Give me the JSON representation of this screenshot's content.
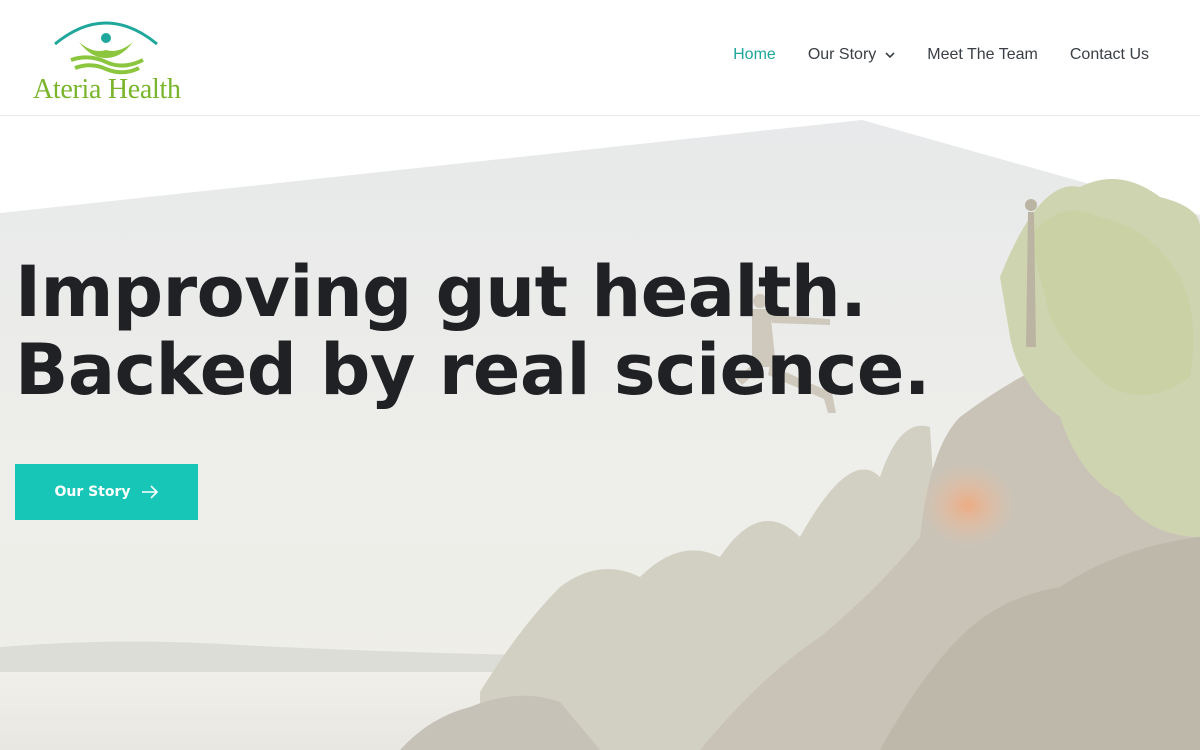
{
  "brand": {
    "name": "Ateria Health",
    "colors": {
      "teal": "#1ea79a",
      "green": "#7ab52c",
      "cta": "#18c6b7",
      "text": "#202124"
    }
  },
  "nav": {
    "items": [
      {
        "label": "Home",
        "active": true
      },
      {
        "label": "Our Story",
        "has_dropdown": true
      },
      {
        "label": "Meet The Team"
      },
      {
        "label": "Contact Us"
      }
    ]
  },
  "hero": {
    "headline_line1": "Improving gut health.",
    "headline_line2": "Backed by real science.",
    "cta_label": "Our Story",
    "cta_icon": "arrow-right-icon"
  }
}
